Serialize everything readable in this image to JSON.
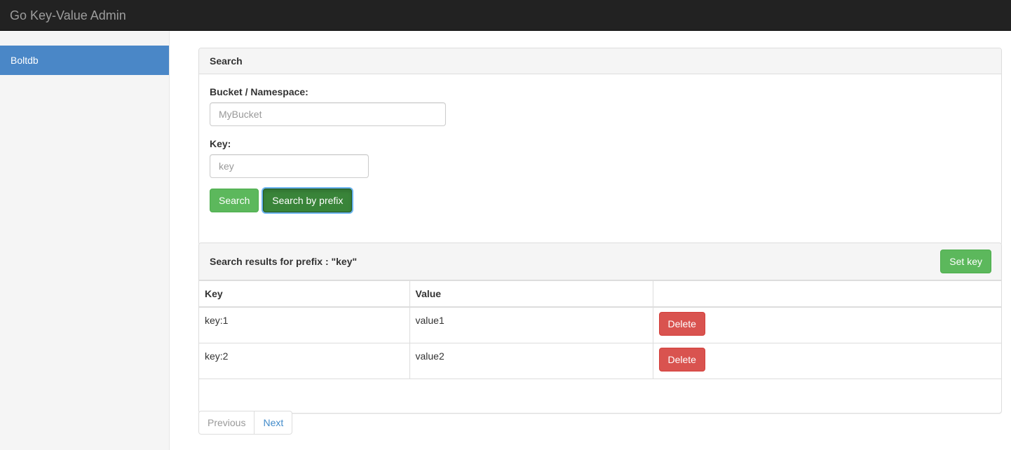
{
  "navbar": {
    "brand": "Go Key-Value Admin"
  },
  "sidebar": {
    "items": [
      {
        "label": "Boltdb",
        "active": true
      }
    ]
  },
  "search_panel": {
    "title": "Search",
    "bucket_label": "Bucket / Namespace:",
    "bucket_placeholder": "MyBucket",
    "bucket_value": "",
    "key_label": "Key:",
    "key_placeholder": "key",
    "key_value": "",
    "search_button": "Search",
    "search_prefix_button": "Search by prefix"
  },
  "results_panel": {
    "title": "Search results for prefix : \"key\"",
    "set_key_button": "Set key",
    "columns": [
      "Key",
      "Value",
      ""
    ],
    "rows": [
      {
        "key": "key:1",
        "value": "value1",
        "action": "Delete"
      },
      {
        "key": "key:2",
        "value": "value2",
        "action": "Delete"
      }
    ]
  },
  "pagination": {
    "previous": "Previous",
    "next": "Next"
  },
  "colors": {
    "navbar_bg": "#222222",
    "sidebar_active": "#4a87c7",
    "success": "#5cb85c",
    "success_active": "#398439",
    "danger": "#d9534f",
    "link": "#428bca",
    "panel_heading_bg": "#f5f5f5",
    "border": "#dddddd"
  }
}
